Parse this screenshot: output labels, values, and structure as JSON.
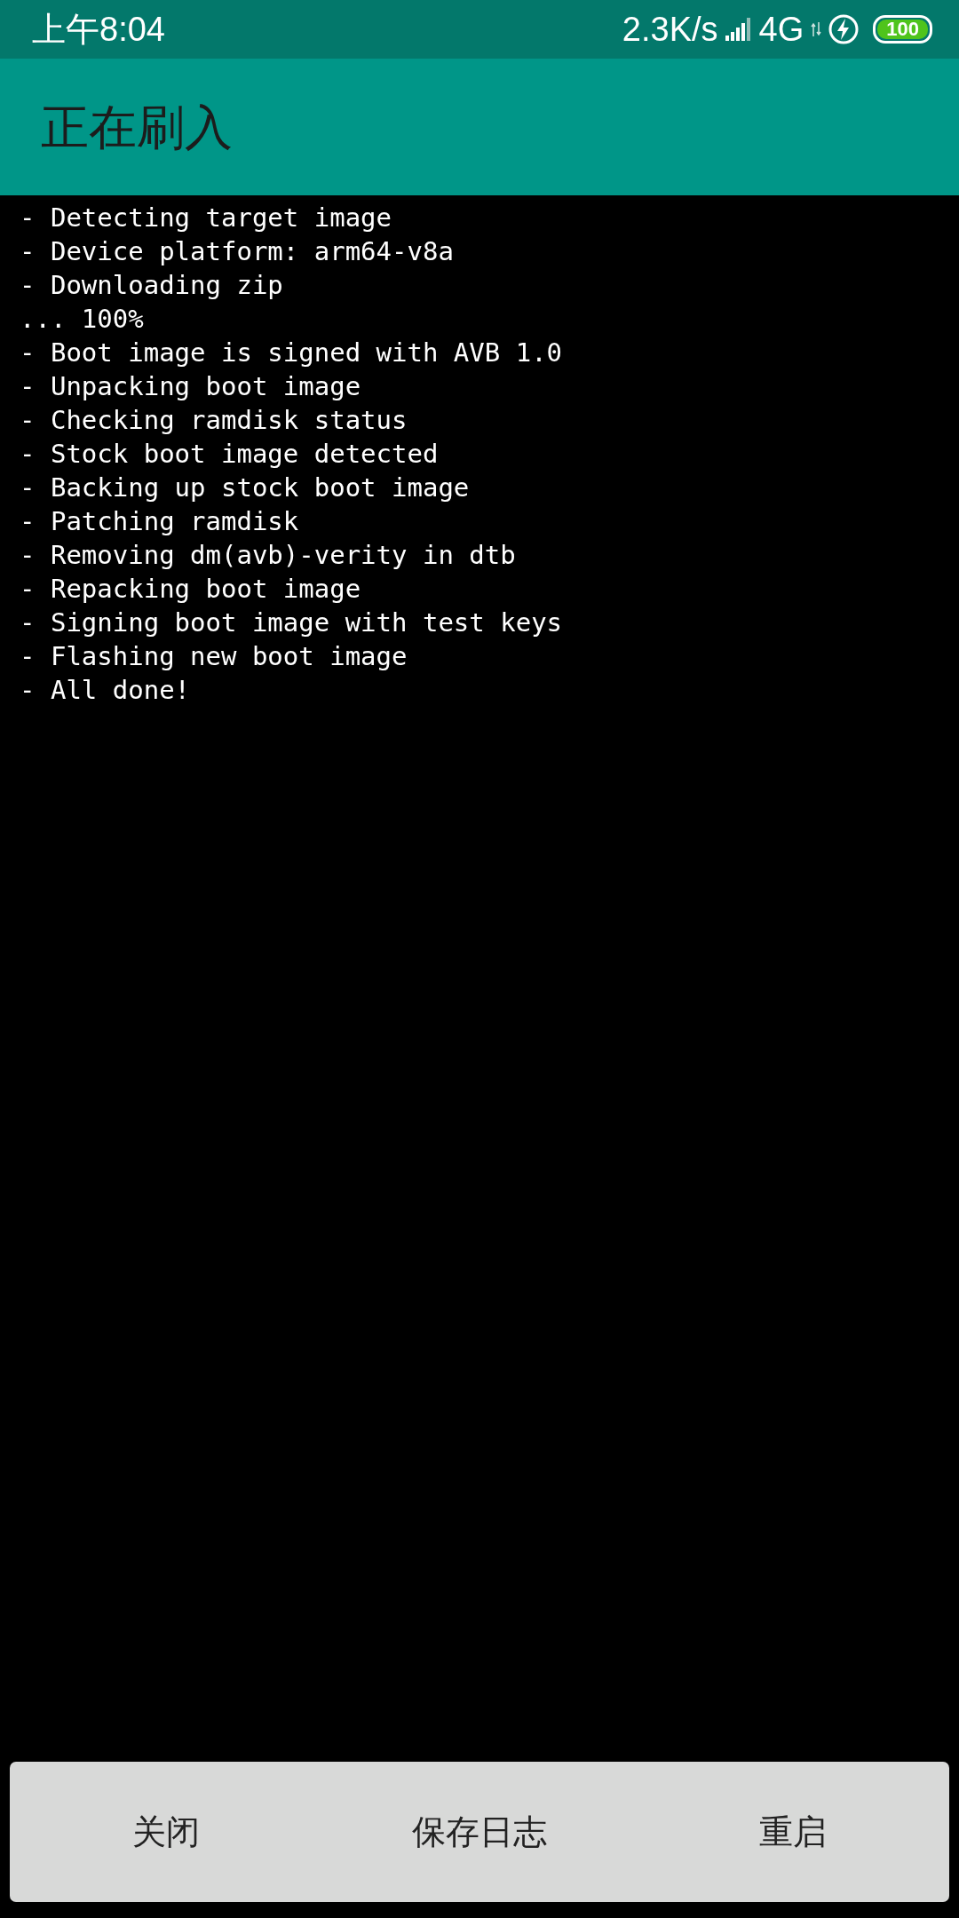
{
  "status_bar": {
    "time": "上午8:04",
    "net_speed": "2.3K/s",
    "network": "4G",
    "battery": "100"
  },
  "app_bar": {
    "title": "正在刷入"
  },
  "log_lines": [
    "- Detecting target image",
    "- Device platform: arm64-v8a",
    "- Downloading zip",
    "... 100%",
    "- Boot image is signed with AVB 1.0",
    "- Unpacking boot image",
    "- Checking ramdisk status",
    "- Stock boot image detected",
    "- Backing up stock boot image",
    "- Patching ramdisk",
    "- Removing dm(avb)-verity in dtb",
    "- Repacking boot image",
    "- Signing boot image with test keys",
    "- Flashing new boot image",
    "- All done!"
  ],
  "buttons": [
    "关闭",
    "保存日志",
    "重启"
  ]
}
